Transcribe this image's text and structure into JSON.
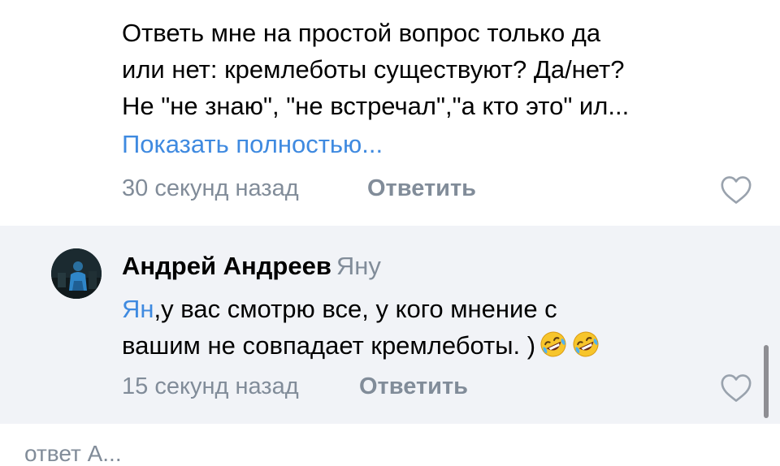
{
  "comment_top": {
    "text_lines": [
      "Ответь мне на простой вопрос только да",
      "или нет: кремлеботы существуют? Да/нет?",
      "Не \"не знаю\", \"не встречал\",\"а кто это\" ил..."
    ],
    "show_more": "Показать полностью...",
    "timestamp": "30 секунд назад",
    "reply_label": "Ответить",
    "like_icon": "heart-icon"
  },
  "comment_reply": {
    "author": "Андрей Андреев",
    "reply_to": "Яну",
    "mention": "Ян",
    "text_line1_rest": ",у вас смотрю все, у кого мнение с",
    "text_line2": "вашим не совпадает кремлеботы. )",
    "emoji": "rolling-on-floor-laughing-emoji",
    "timestamp": "15 секунд назад",
    "reply_label": "Ответить",
    "like_icon": "heart-icon"
  },
  "next_hint": "ответ А..."
}
